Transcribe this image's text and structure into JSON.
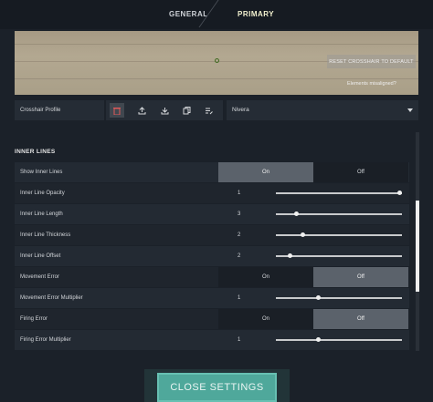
{
  "tabs": [
    {
      "label": "GENERAL",
      "active": false
    },
    {
      "label": "PRIMARY",
      "active": true
    }
  ],
  "preview": {
    "reset_label": "RESET CROSSHAIR TO DEFAULT",
    "misaligned_label": "Elements misaligned?"
  },
  "profile": {
    "label": "Crosshair Profile",
    "selected": "Nivera",
    "actions": [
      "delete-icon",
      "upload-icon",
      "download-icon",
      "copy-icon",
      "rename-icon"
    ]
  },
  "section": {
    "title": "INNER LINES"
  },
  "settings": {
    "show_inner_lines": {
      "label": "Show Inner Lines",
      "on_label": "On",
      "off_label": "Off",
      "value": "On"
    },
    "inner_line_opacity": {
      "label": "Inner Line Opacity",
      "value": "1",
      "fraction": 1.0
    },
    "inner_line_length": {
      "label": "Inner Line Length",
      "value": "3",
      "fraction": 0.15
    },
    "inner_line_thickness": {
      "label": "Inner Line Thickness",
      "value": "2",
      "fraction": 0.2
    },
    "inner_line_offset": {
      "label": "Inner Line Offset",
      "value": "2",
      "fraction": 0.1
    },
    "movement_error": {
      "label": "Movement Error",
      "on_label": "On",
      "off_label": "Off",
      "value": "Off"
    },
    "movement_error_multiplier": {
      "label": "Movement Error Multiplier",
      "value": "1",
      "fraction": 0.33
    },
    "firing_error": {
      "label": "Firing Error",
      "on_label": "On",
      "off_label": "Off",
      "value": "Off"
    },
    "firing_error_multiplier": {
      "label": "Firing Error Multiplier",
      "value": "1",
      "fraction": 0.33
    }
  },
  "footer": {
    "close_label": "CLOSE SETTINGS"
  },
  "colors": {
    "accent": "#4fa89b",
    "active_tab": "#f2f1cf",
    "toggle_active": "#5b626b"
  }
}
